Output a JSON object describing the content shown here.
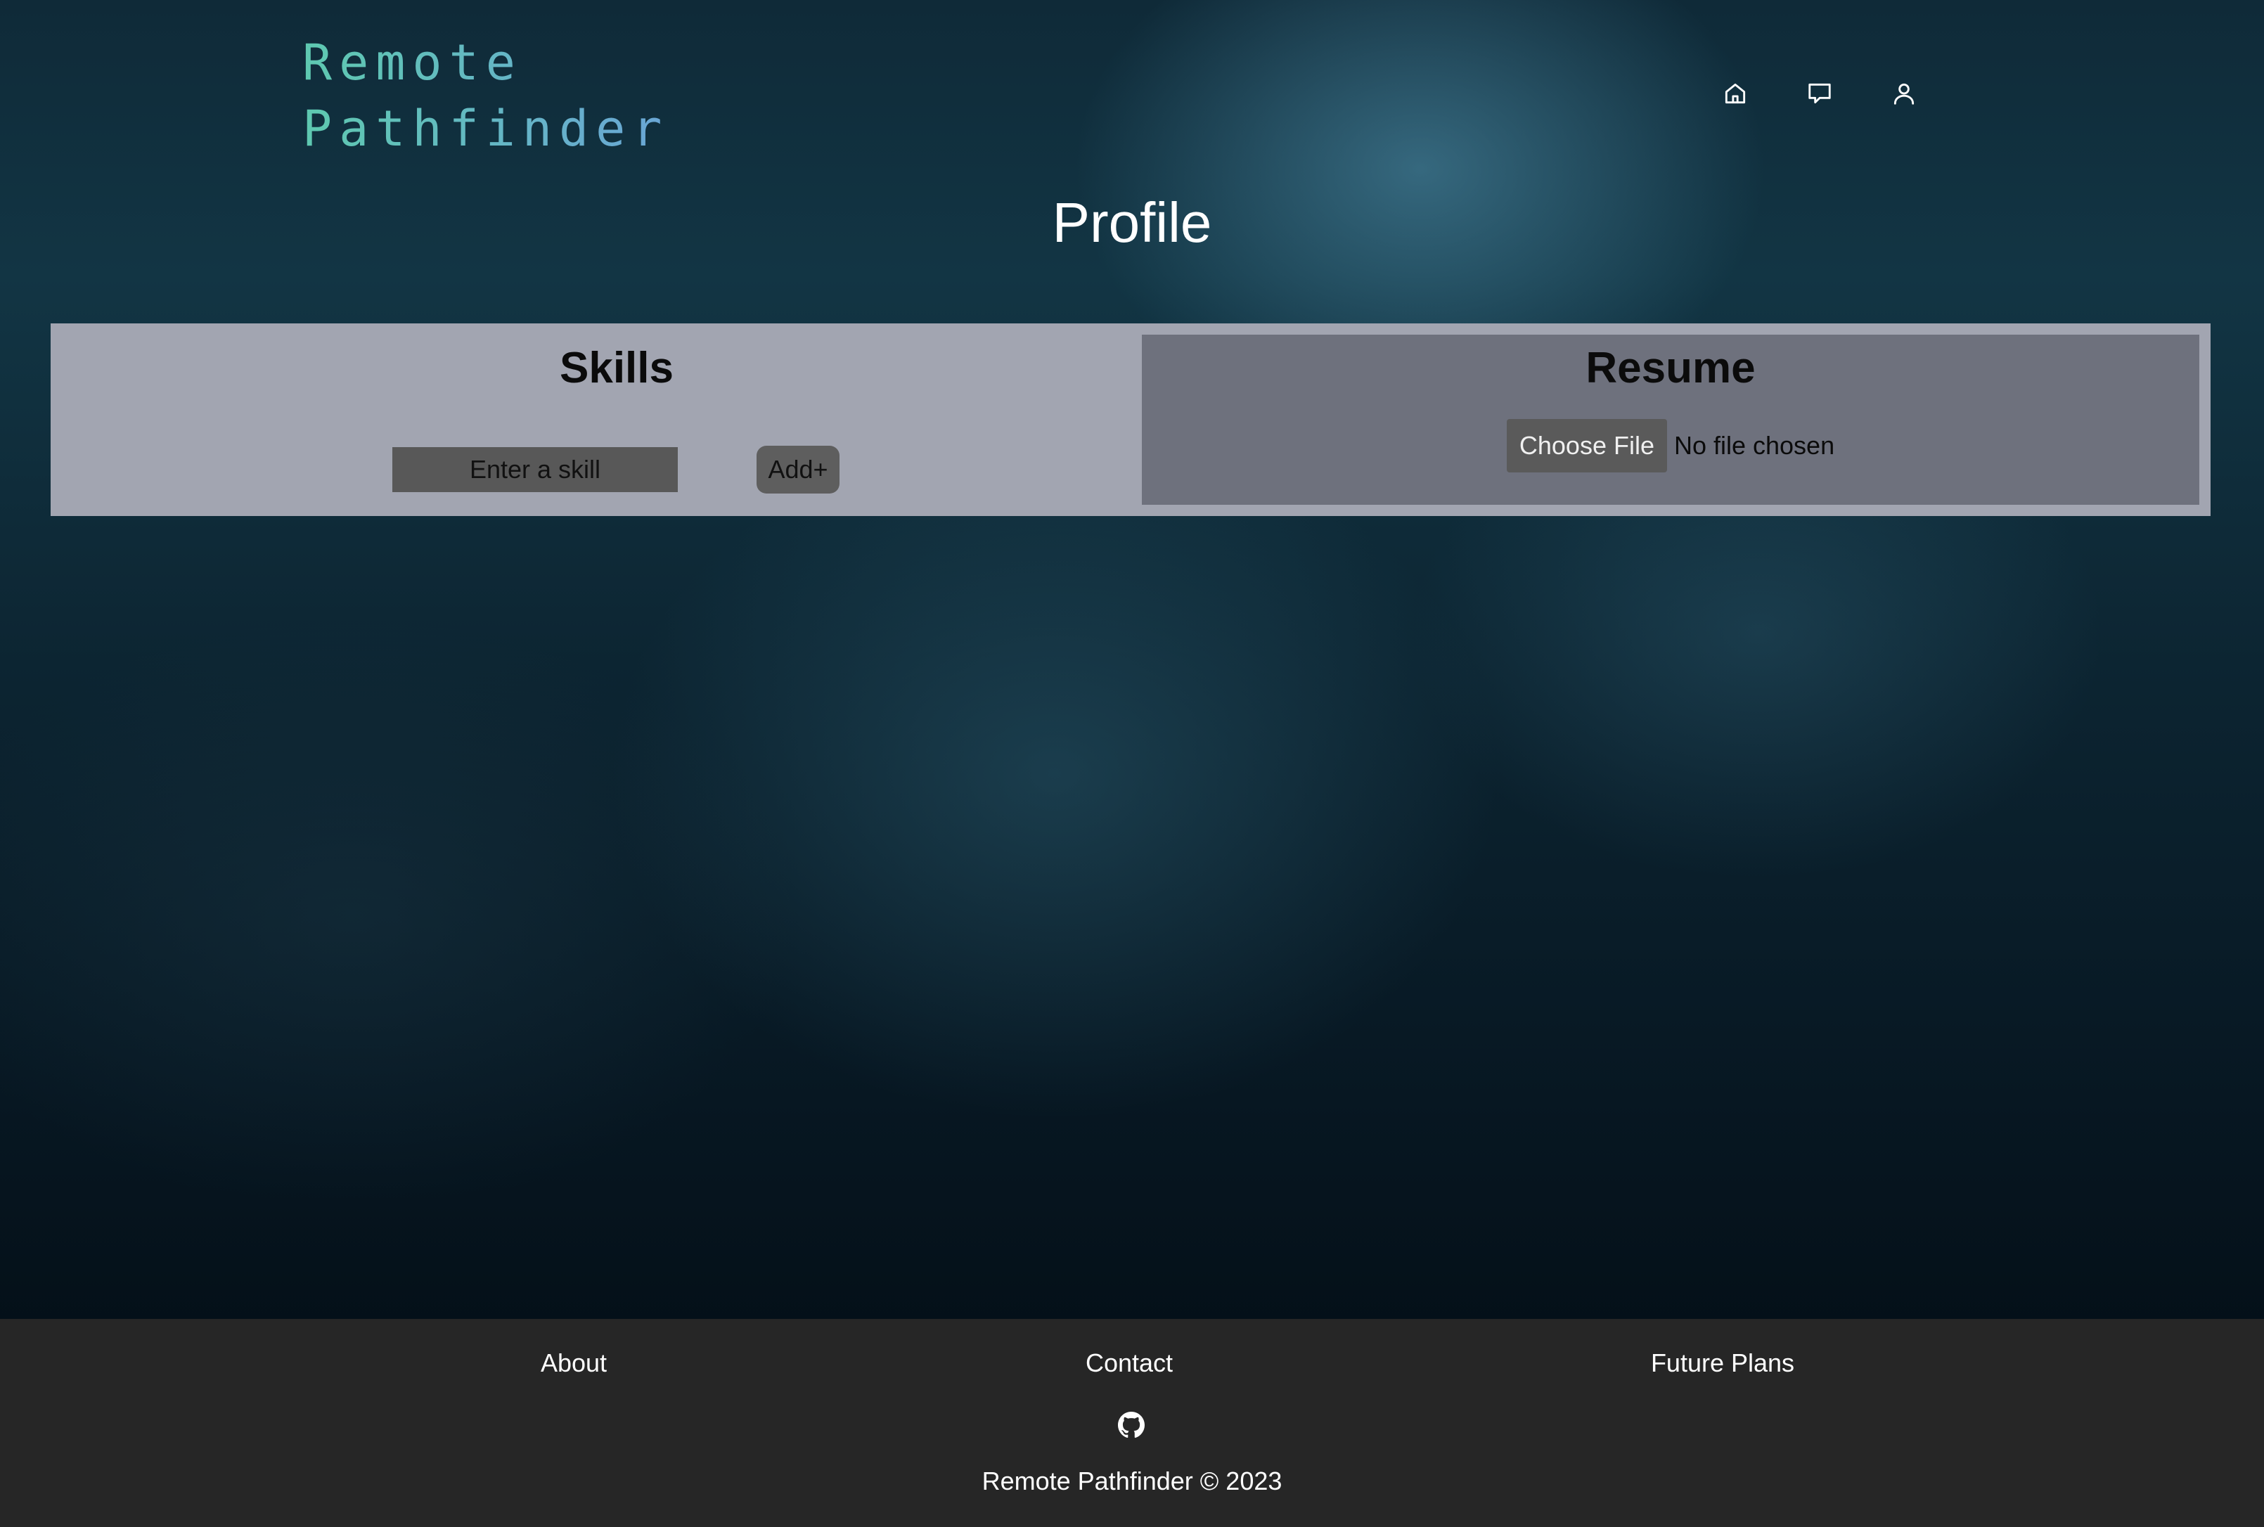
{
  "header": {
    "logo_line1": "Remote",
    "logo_line2": "Pathfinder",
    "nav": [
      {
        "icon": "home-icon"
      },
      {
        "icon": "chat-icon"
      },
      {
        "icon": "user-icon"
      }
    ]
  },
  "page": {
    "title": "Profile"
  },
  "skills": {
    "title": "Skills",
    "input_placeholder": "Enter a skill",
    "add_label": "Add+"
  },
  "resume": {
    "title": "Resume",
    "choose_file_label": "Choose File",
    "file_status": "No file chosen"
  },
  "footer": {
    "links": [
      "About",
      "Contact",
      "Future Plans"
    ],
    "social_icon": "github-icon",
    "copyright": "Remote Pathfinder © 2023"
  },
  "colors": {
    "logo_gradient_start": "#5ec9b0",
    "logo_gradient_end": "#6aa6d6",
    "panel_bg": "#a2a5b1",
    "resume_bg": "#6e717d",
    "footer_bg": "#262626"
  }
}
